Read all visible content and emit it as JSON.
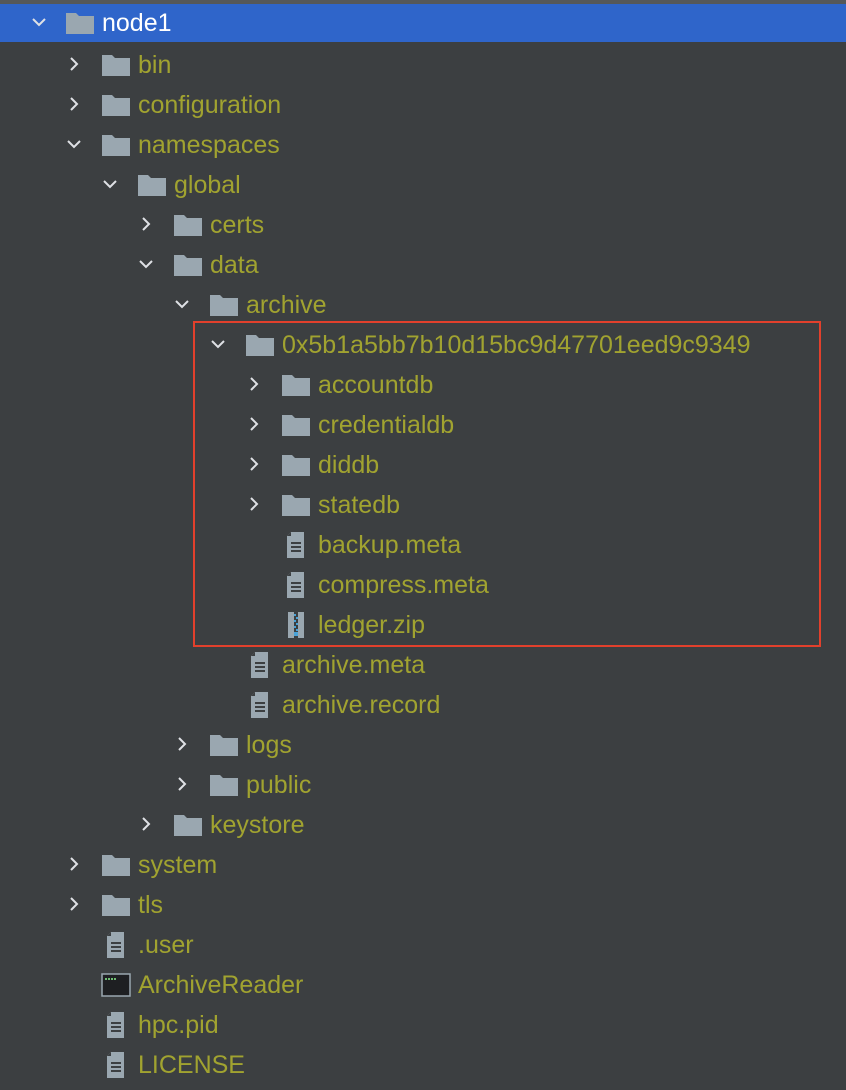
{
  "colors": {
    "background": "#3c3f41",
    "selection": "#2f65ca",
    "label": "#a1a330",
    "highlight_border": "#e2402c",
    "folder_icon": "#9aa7b0"
  },
  "tree": [
    {
      "label": "node1",
      "type": "folder",
      "state": "expanded",
      "selected": true
    },
    {
      "label": "bin",
      "type": "folder",
      "state": "collapsed"
    },
    {
      "label": "configuration",
      "type": "folder",
      "state": "collapsed"
    },
    {
      "label": "namespaces",
      "type": "folder",
      "state": "expanded"
    },
    {
      "label": "global",
      "type": "folder",
      "state": "expanded"
    },
    {
      "label": "certs",
      "type": "folder",
      "state": "collapsed"
    },
    {
      "label": "data",
      "type": "folder",
      "state": "expanded"
    },
    {
      "label": "archive",
      "type": "folder",
      "state": "expanded"
    },
    {
      "label": "0x5b1a5bb7b10d15bc9d47701eed9c9349",
      "type": "folder",
      "state": "expanded"
    },
    {
      "label": "accountdb",
      "type": "folder",
      "state": "collapsed"
    },
    {
      "label": "credentialdb",
      "type": "folder",
      "state": "collapsed"
    },
    {
      "label": "diddb",
      "type": "folder",
      "state": "collapsed"
    },
    {
      "label": "statedb",
      "type": "folder",
      "state": "collapsed"
    },
    {
      "label": "backup.meta",
      "type": "text-file"
    },
    {
      "label": "compress.meta",
      "type": "text-file"
    },
    {
      "label": "ledger.zip",
      "type": "zip-file"
    },
    {
      "label": "archive.meta",
      "type": "text-file"
    },
    {
      "label": "archive.record",
      "type": "text-file"
    },
    {
      "label": "logs",
      "type": "folder",
      "state": "collapsed"
    },
    {
      "label": "public",
      "type": "folder",
      "state": "collapsed"
    },
    {
      "label": "keystore",
      "type": "folder",
      "state": "collapsed"
    },
    {
      "label": "system",
      "type": "folder",
      "state": "collapsed"
    },
    {
      "label": "tls",
      "type": "folder",
      "state": "collapsed"
    },
    {
      "label": ".user",
      "type": "text-file"
    },
    {
      "label": "ArchiveReader",
      "type": "executable"
    },
    {
      "label": "hpc.pid",
      "type": "text-file"
    },
    {
      "label": "LICENSE",
      "type": "text-file"
    }
  ]
}
